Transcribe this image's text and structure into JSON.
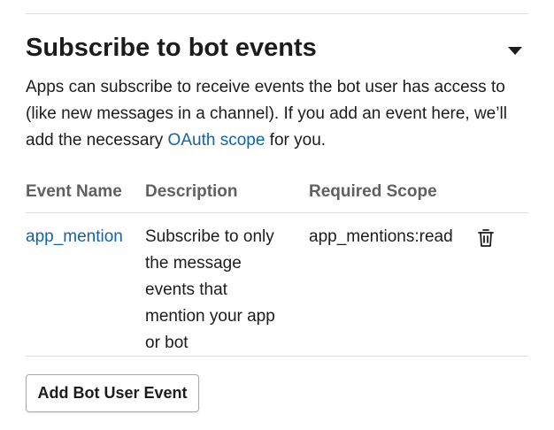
{
  "section": {
    "title": "Subscribe to bot events",
    "toggle_icon": "caret-down-icon",
    "intro": {
      "line1": "Apps can subscribe to receive events the bot user has access to",
      "line2": "(like new messages in a channel). If you add an event here, we’ll",
      "line3_before": "add the necessary ",
      "link_text": "OAuth scope",
      "line3_after": " for you."
    },
    "link_color": "#1264a3"
  },
  "table": {
    "headers": {
      "event_name": "Event Name",
      "description": "Description",
      "required_scope": "Required Scope"
    },
    "rows": [
      {
        "event_name": "app_mention",
        "description_lines": [
          "Subscribe to only",
          "the message",
          "events that",
          "mention your app",
          "or bot"
        ],
        "required_scope": "app_mentions:read",
        "action_icon": "trash-icon"
      }
    ]
  },
  "actions": {
    "add_button_label": "Add Bot User Event"
  }
}
